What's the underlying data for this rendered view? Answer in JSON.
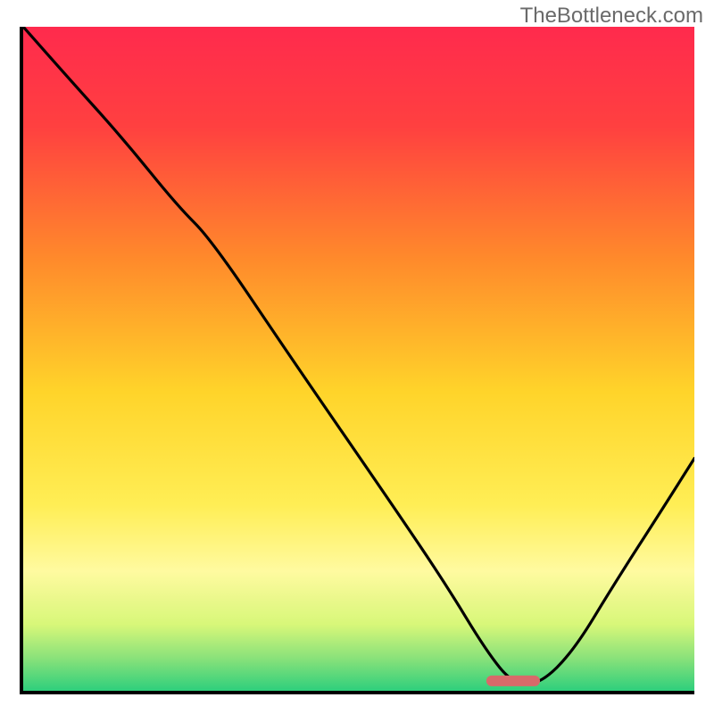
{
  "watermark": "TheBottleneck.com",
  "chart_data": {
    "type": "line",
    "title": "",
    "xlabel": "",
    "ylabel": "",
    "xlim": [
      0,
      100
    ],
    "ylim": [
      0,
      100
    ],
    "grid": false,
    "legend": false,
    "background_gradient": {
      "stops": [
        {
          "offset": 0.0,
          "color": "#ff2a4d"
        },
        {
          "offset": 0.15,
          "color": "#ff4040"
        },
        {
          "offset": 0.35,
          "color": "#ff8a2b"
        },
        {
          "offset": 0.55,
          "color": "#ffd42a"
        },
        {
          "offset": 0.72,
          "color": "#ffee55"
        },
        {
          "offset": 0.82,
          "color": "#fffaa0"
        },
        {
          "offset": 0.9,
          "color": "#d8f779"
        },
        {
          "offset": 0.95,
          "color": "#8be27a"
        },
        {
          "offset": 1.0,
          "color": "#2ecf7c"
        }
      ]
    },
    "series": [
      {
        "name": "bottleneck-curve",
        "x": [
          0,
          7,
          15,
          23,
          28,
          40,
          55,
          63,
          69,
          73,
          77,
          82,
          88,
          95,
          100
        ],
        "y": [
          100,
          92,
          83,
          73,
          68,
          50,
          28,
          16,
          6,
          1,
          1,
          6,
          16,
          27,
          35
        ]
      }
    ],
    "marker": {
      "name": "optimal-range",
      "x_center": 73,
      "y": 1.5,
      "width": 8,
      "color": "#d86a6a"
    }
  }
}
